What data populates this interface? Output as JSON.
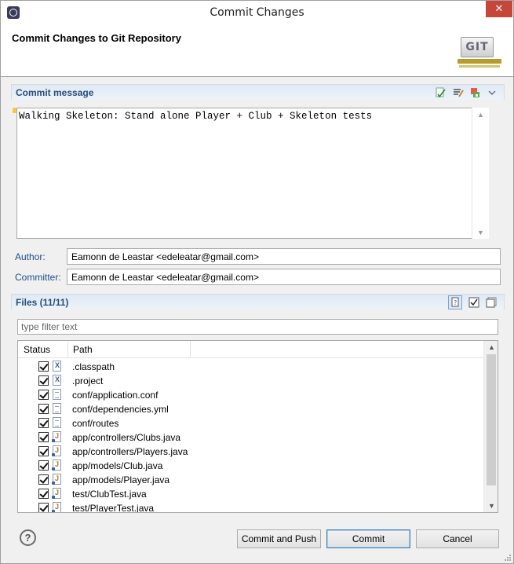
{
  "window": {
    "title": "Commit Changes",
    "close_glyph": "✕"
  },
  "header": {
    "title": "Commit Changes to Git Repository",
    "logo_text": "GIT"
  },
  "commit_message": {
    "section_title": "Commit message",
    "text": "Walking Skeleton: Stand alone Player + Club + Skeleton tests"
  },
  "author": {
    "label": "Author:",
    "value": "Eamonn de Leastar <edeleatar@gmail.com>"
  },
  "committer": {
    "label": "Committer:",
    "value": "Eamonn de Leastar <edeleatar@gmail.com>"
  },
  "files": {
    "section_title": "Files (11/11)",
    "filter_placeholder": "type filter text",
    "columns": {
      "status": "Status",
      "path": "Path"
    },
    "rows": [
      {
        "path": ".classpath",
        "icon": "xml-file-icon",
        "checked": true
      },
      {
        "path": ".project",
        "icon": "xml-file-icon",
        "checked": true
      },
      {
        "path": "conf/application.conf",
        "icon": "text-file-icon",
        "checked": true
      },
      {
        "path": "conf/dependencies.yml",
        "icon": "text-file-icon",
        "checked": true
      },
      {
        "path": "conf/routes",
        "icon": "text-file-icon",
        "checked": true
      },
      {
        "path": "app/controllers/Clubs.java",
        "icon": "java-file-icon",
        "checked": true
      },
      {
        "path": "app/controllers/Players.java",
        "icon": "java-file-icon",
        "checked": true
      },
      {
        "path": "app/models/Club.java",
        "icon": "java-file-icon",
        "checked": true
      },
      {
        "path": "app/models/Player.java",
        "icon": "java-file-icon",
        "checked": true
      },
      {
        "path": "test/ClubTest.java",
        "icon": "java-file-icon",
        "checked": true
      },
      {
        "path": "test/PlayerTest.java",
        "icon": "java-file-icon",
        "checked": true
      }
    ]
  },
  "buttons": {
    "help": "?",
    "commit_and_push": "Commit and Push",
    "commit": "Commit",
    "cancel": "Cancel"
  },
  "colors": {
    "section_title": "#284e7a",
    "label": "#1d4e89",
    "close_button": "#c7463a"
  }
}
